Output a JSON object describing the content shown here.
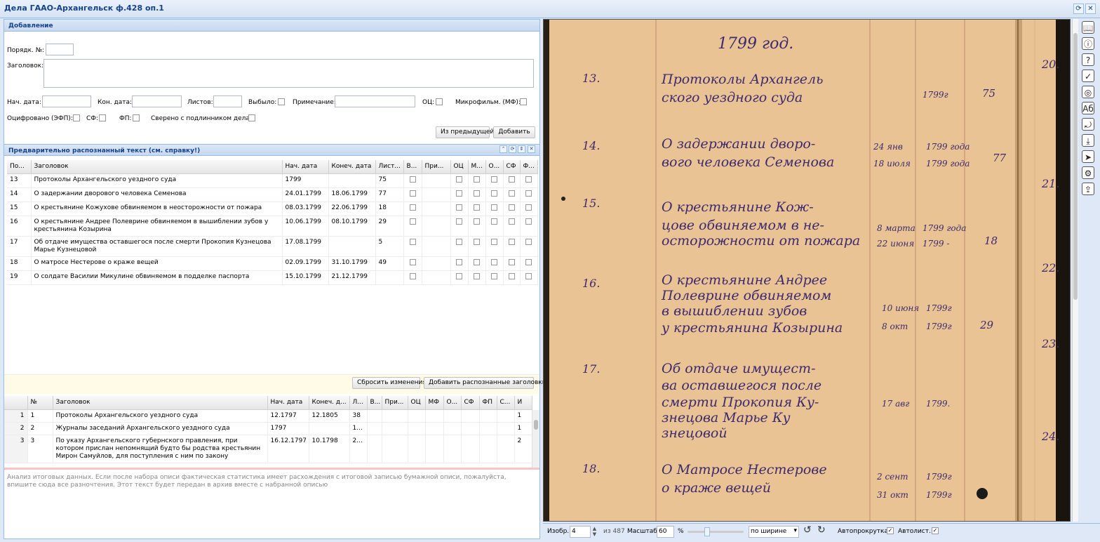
{
  "window": {
    "title": "Дела ГААО-Архангельск ф.428 оп.1"
  },
  "add_panel": {
    "title": "Добавление",
    "order_label": "Порядк. №:",
    "heading_label": "Заголовок:",
    "start_label": "Нач. дата:",
    "end_label": "Кон. дата:",
    "sheets_label": "Листов:",
    "dropped_label": "Выбыло:",
    "note_label": "Примечание:",
    "oc_label": "ОЦ:",
    "mf_label": "Микрофильм. (МФ):",
    "efp_label": "Оцифровано (ЭФП):",
    "sf_label": "СФ:",
    "fp_label": "ФП:",
    "verified_label": "Сверено с подлинником дела:",
    "from_prev": "Из предыдущей",
    "add": "Добавить"
  },
  "recognized": {
    "title": "Предварительно распознанный текст (см. справку!)",
    "columns": [
      "По...",
      "Заголовок",
      "Нач. дата",
      "Конеч. дата",
      "Лист...",
      "В...",
      "При...",
      "ОЦ",
      "М...",
      "О...",
      "СФ",
      "Ф..."
    ],
    "rows": [
      {
        "n": "13",
        "t": "Протоколы Архангельского уездного суда",
        "s": "1799",
        "e": "",
        "l": "75"
      },
      {
        "n": "14",
        "t": "О задержании дворового человека Семенова",
        "s": "24.01.1799",
        "e": "18.06.1799",
        "l": "77"
      },
      {
        "n": "15",
        "t": "О крестьянине Кожухове обвиняемом в неосторожности от пожара",
        "s": "08.03.1799",
        "e": "22.06.1799",
        "l": "18"
      },
      {
        "n": "16",
        "t": "О крестьянине Андрее Полеврине обвиняемом в вышиблении зубов у крестьянина Козырина",
        "s": "10.06.1799",
        "e": "08.10.1799",
        "l": "29"
      },
      {
        "n": "17",
        "t": "Об отдаче имущества оставшегося после смерти Прокопия Кузнецова Марье Кузнецовой",
        "s": "17.08.1799",
        "e": "",
        "l": "5"
      },
      {
        "n": "18",
        "t": "О матросе Нестерове о краже вещей",
        "s": "02.09.1799",
        "e": "31.10.1799",
        "l": "49"
      },
      {
        "n": "19",
        "t": "О солдате Василии Микулине обвиняемом в подделке паспорта",
        "s": "15.10.1799",
        "e": "21.12.1799",
        "l": ""
      }
    ],
    "reset": "Сбросить изменения",
    "add_recognized": "Добавить распознанные заголовки"
  },
  "saved": {
    "columns": [
      "",
      "№",
      "Заголовок",
      "Нач. дата",
      "Конеч. д...",
      "Л...",
      "В...",
      "При...",
      "ОЦ",
      "МФ",
      "О...",
      "СФ",
      "ФП",
      "С...",
      "И"
    ],
    "rows": [
      {
        "i": "1",
        "n": "1",
        "t": "Протоколы Архангельского уездного суда",
        "s": "12.1797",
        "e": "12.1805",
        "l": "38",
        "x": "1"
      },
      {
        "i": "2",
        "n": "2",
        "t": "Журналы заседаний Архангельского уездного суда",
        "s": "1797",
        "e": "",
        "l": "1...",
        "x": "1"
      },
      {
        "i": "3",
        "n": "3",
        "t": "По указу Архангельского губернского правления, при котором прислан непомнящий будто бы родства крестьянин Мирон Самуйлов, для поступления с ним по закону",
        "s": "16.12.1797",
        "e": "10.1798",
        "l": "2...",
        "x": "2"
      }
    ]
  },
  "analysis_placeholder": "Анализ итоговых данных. Если после набора описи фактическая статистика имеет расхождения с итоговой записью бумажной описи, пожалуйста, впишите сюда все разночтения. Этот текст будет передан в архив вместе с набранной описью",
  "viewer": {
    "image_label": "Изобр.",
    "image_value": "4",
    "of": "из 487",
    "scale_label": "Масштаб:",
    "scale_value": "60",
    "percent": "%",
    "fit": "по ширине",
    "autoscroll": "Автопрокрутка:",
    "autopage": "Автолист.:"
  },
  "manuscript": {
    "year": "1799 год.",
    "nums": [
      "13.",
      "14.",
      "15.",
      "16.",
      "17.",
      "18."
    ],
    "page_nums": [
      "20.",
      "21.",
      "22.",
      "23.",
      "24."
    ],
    "lines": [
      "Протоколы Архангель",
      "ского уездного суда",
      "О задержании дворо-",
      "вого человека Семенова",
      "О крестьянине Кож-",
      "цове обвиняемом в не-",
      "осторожности от пожара",
      "О крестьянине Андрее",
      "Полеврине обвиняемом",
      "в вышиблении зубов",
      "у крестьянина Козырина",
      "Об отдаче имущест-",
      "ва оставшегося после",
      "смерти Прокопия Ку-",
      "знецова Марье Ку",
      "знецовой",
      "О Матросе Нестерове",
      "о краже вещей"
    ],
    "dates": [
      "1799г",
      "24 янв",
      "18 июля",
      "1799 года",
      "1799 года",
      "8 марта",
      "22 июня",
      "1799 года",
      "1799 -",
      "10 июня",
      "8 окт",
      "1799г",
      "1799г",
      "17 авг",
      "1799.",
      "2 сент",
      "31 окт",
      "1799г",
      "1799г"
    ],
    "sheets": [
      "75",
      "77",
      "18",
      "29"
    ]
  },
  "colors": {
    "accent": "#15428b",
    "panel_header": "#dae7f6",
    "paper": "#e9c394",
    "ink": "#3d2a6e"
  },
  "toolbar_icons": [
    "book-icon",
    "info-icon",
    "help-icon",
    "check-circle-icon",
    "globe-icon",
    "spellcheck-icon",
    "rotate-icon",
    "download-icon",
    "send-icon",
    "settings-icon",
    "export-icon"
  ]
}
